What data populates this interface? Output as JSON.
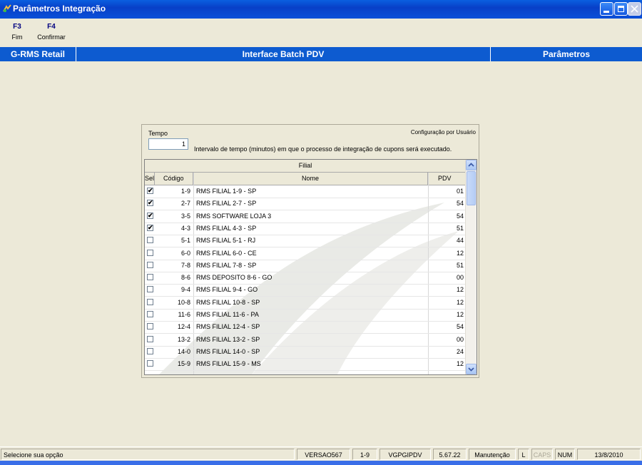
{
  "window": {
    "title": "Parâmetros Integração"
  },
  "toolbar": [
    {
      "key": "F3",
      "label": "Fim"
    },
    {
      "key": "F4",
      "label": "Confirmar"
    }
  ],
  "header": {
    "left": "G-RMS Retail",
    "center": "Interface Batch PDV",
    "right": "Parâmetros"
  },
  "panel": {
    "tempo_label": "Tempo",
    "tempo_value": "1",
    "config_note": "Configuração por Usuário",
    "tempo_description": "Intervalo de tempo (minutos) em que o processo de integração de cupons será executado.",
    "grid": {
      "group_header": "Filial",
      "columns": [
        "Sel",
        "Código",
        "Nome",
        "PDV"
      ],
      "rows": [
        {
          "checked": true,
          "codigo": "1-9",
          "nome": "RMS FILIAL 1-9 - SP",
          "pdv": "01"
        },
        {
          "checked": true,
          "codigo": "2-7",
          "nome": "RMS FILIAL 2-7 - SP",
          "pdv": "54"
        },
        {
          "checked": true,
          "codigo": "3-5",
          "nome": "RMS SOFTWARE LOJA 3",
          "pdv": "54"
        },
        {
          "checked": true,
          "codigo": "4-3",
          "nome": "RMS FILIAL 4-3 - SP",
          "pdv": "51"
        },
        {
          "checked": false,
          "codigo": "5-1",
          "nome": "RMS FILIAL 5-1 - RJ",
          "pdv": "44"
        },
        {
          "checked": false,
          "codigo": "6-0",
          "nome": "RMS FILIAL 6-0 - CE",
          "pdv": "12"
        },
        {
          "checked": false,
          "codigo": "7-8",
          "nome": "RMS FILIAL 7-8 - SP",
          "pdv": "51"
        },
        {
          "checked": false,
          "codigo": "8-6",
          "nome": "RMS DEPOSITO 8-6 - GO",
          "pdv": "00"
        },
        {
          "checked": false,
          "codigo": "9-4",
          "nome": "RMS FILIAL 9-4 - GO",
          "pdv": "12"
        },
        {
          "checked": false,
          "codigo": "10-8",
          "nome": "RMS FILIAL 10-8 - SP",
          "pdv": "12"
        },
        {
          "checked": false,
          "codigo": "11-6",
          "nome": "RMS FILIAL 11-6 - PA",
          "pdv": "12"
        },
        {
          "checked": false,
          "codigo": "12-4",
          "nome": "RMS FILIAL 12-4 - SP",
          "pdv": "54"
        },
        {
          "checked": false,
          "codigo": "13-2",
          "nome": "RMS FILIAL 13-2 - SP",
          "pdv": "00"
        },
        {
          "checked": false,
          "codigo": "14-0",
          "nome": "RMS FILIAL 14-0 - SP",
          "pdv": "24"
        },
        {
          "checked": false,
          "codigo": "15-9",
          "nome": "RMS FILIAL 15-9 - MS",
          "pdv": "12"
        }
      ]
    }
  },
  "statusbar": {
    "message": "Selecione sua opção",
    "version": "VERSAO567",
    "filial": "1-9",
    "program": "VGPGIPDV",
    "build": "5.67.22",
    "mode": "Manutenção",
    "l": "L",
    "caps": "CAPS",
    "num": "NUM",
    "date": "13/8/2010"
  },
  "colors": {
    "title_bar": "#0a4fd8",
    "header_bar": "#0d5bd0",
    "background": "#ece9d8",
    "fkey_text": "#000080"
  },
  "icons": [
    "app-icon",
    "minimize-icon",
    "maximize-icon",
    "close-icon",
    "checkbox-icon",
    "scroll-up-icon",
    "scroll-down-icon"
  ]
}
